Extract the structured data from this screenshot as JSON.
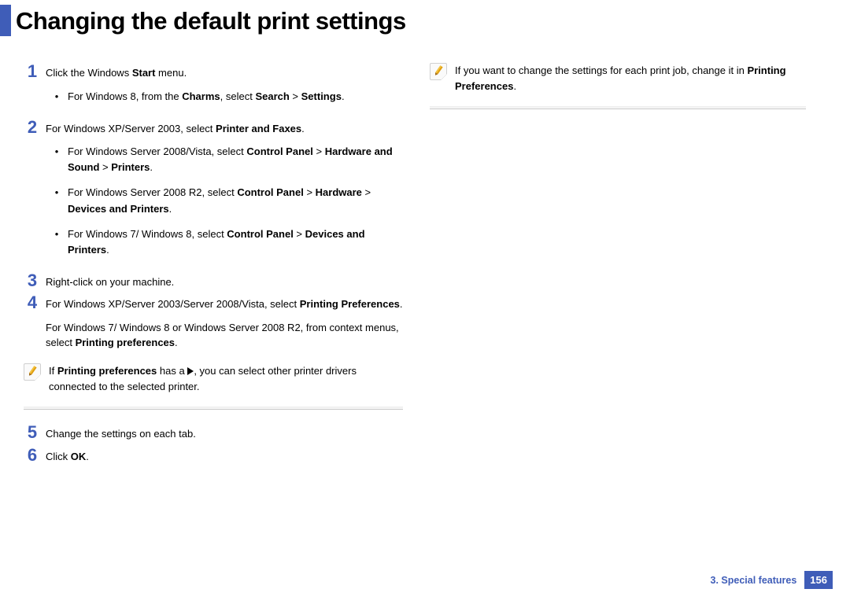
{
  "title": "Changing the default print settings",
  "steps": {
    "s1": {
      "num": "1",
      "text_parts": [
        "Click the Windows ",
        "Start",
        " menu."
      ],
      "bullets": [
        {
          "parts": [
            "For Windows 8, from the ",
            "Charms",
            ", select ",
            "Search",
            " > ",
            "Settings",
            "."
          ]
        }
      ]
    },
    "s2": {
      "num": "2",
      "text_parts": [
        "For Windows XP/Server 2003, select ",
        "Printer and Faxes",
        "."
      ],
      "bullets": [
        {
          "parts": [
            "For Windows Server 2008/Vista, select ",
            "Control Panel",
            " > ",
            "Hardware and Sound",
            " > ",
            "Printers",
            "."
          ]
        },
        {
          "parts": [
            "For Windows Server 2008 R2, select ",
            "Control Panel",
            " > ",
            "Hardware",
            " > ",
            "Devices and Printers",
            "."
          ]
        },
        {
          "parts": [
            "For Windows 7/ Windows 8, select ",
            "Control Panel",
            " > ",
            "Devices and Printers",
            "."
          ]
        }
      ]
    },
    "s3": {
      "num": "3",
      "text": "Right-click on your machine."
    },
    "s4": {
      "num": "4",
      "p1_parts": [
        "For Windows XP/Server 2003/Server 2008/Vista, select ",
        "Printing Preferences",
        "."
      ],
      "p2_parts": [
        "For Windows 7/ Windows 8 or Windows Server 2008 R2, from context menus, select ",
        "Printing preferences",
        "."
      ]
    },
    "s5": {
      "num": "5",
      "text": "Change the settings on each tab."
    },
    "s6": {
      "num": "6",
      "text_parts": [
        "Click ",
        "OK",
        "."
      ]
    }
  },
  "note1": {
    "pre": "If ",
    "bold": "Printing preferences",
    "mid": " has a ",
    "post": ", you can select other printer drivers connected to the selected printer."
  },
  "note2": {
    "parts": [
      "If you want to change the settings for each print job, change it in ",
      "Printing Preferences",
      "."
    ]
  },
  "footer": {
    "chapter": "3.  Special features",
    "page": "156"
  }
}
